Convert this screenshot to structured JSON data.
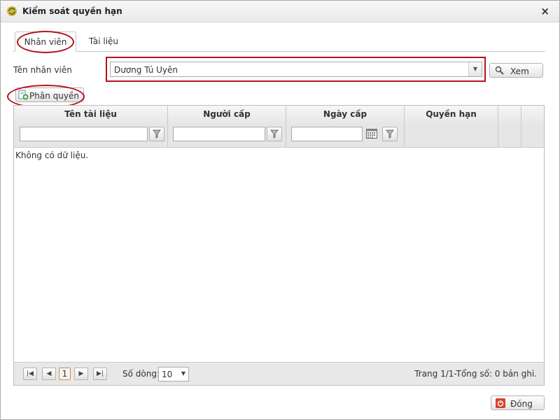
{
  "window": {
    "title": "Kiểm soát quyền hạn",
    "close_glyph": "×"
  },
  "tabs": [
    {
      "label": "Nhân viên",
      "active": true
    },
    {
      "label": "Tài liệu",
      "active": false
    }
  ],
  "filter": {
    "employee_label": "Tên nhân viên",
    "employee_value": "Dương Tú Uyên",
    "view_button": "Xem"
  },
  "toolbar": {
    "assign_button": "Phân quyền"
  },
  "grid": {
    "columns": [
      "Tên tài liệu",
      "Người cấp",
      "Ngày cấp",
      "Quyền hạn"
    ],
    "empty_text": "Không có dữ liệu.",
    "rows": []
  },
  "pager": {
    "current_page": "1",
    "rows_label": "Số dòng:",
    "rows_per_page": "10",
    "info": "Trang 1/1-Tổng số: 0 bản ghi."
  },
  "footer": {
    "close_button": "Đóng"
  },
  "colors": {
    "highlight": "#b4121c",
    "current_page_border": "#e08a3c",
    "close_icon": "#d9402b"
  },
  "icons": {
    "app": "refresh-gear-icon",
    "view": "search-icon",
    "assign": "document-add-icon",
    "filter": "filter-funnel-icon",
    "calendar": "calendar-icon",
    "close_action": "power-icon"
  }
}
